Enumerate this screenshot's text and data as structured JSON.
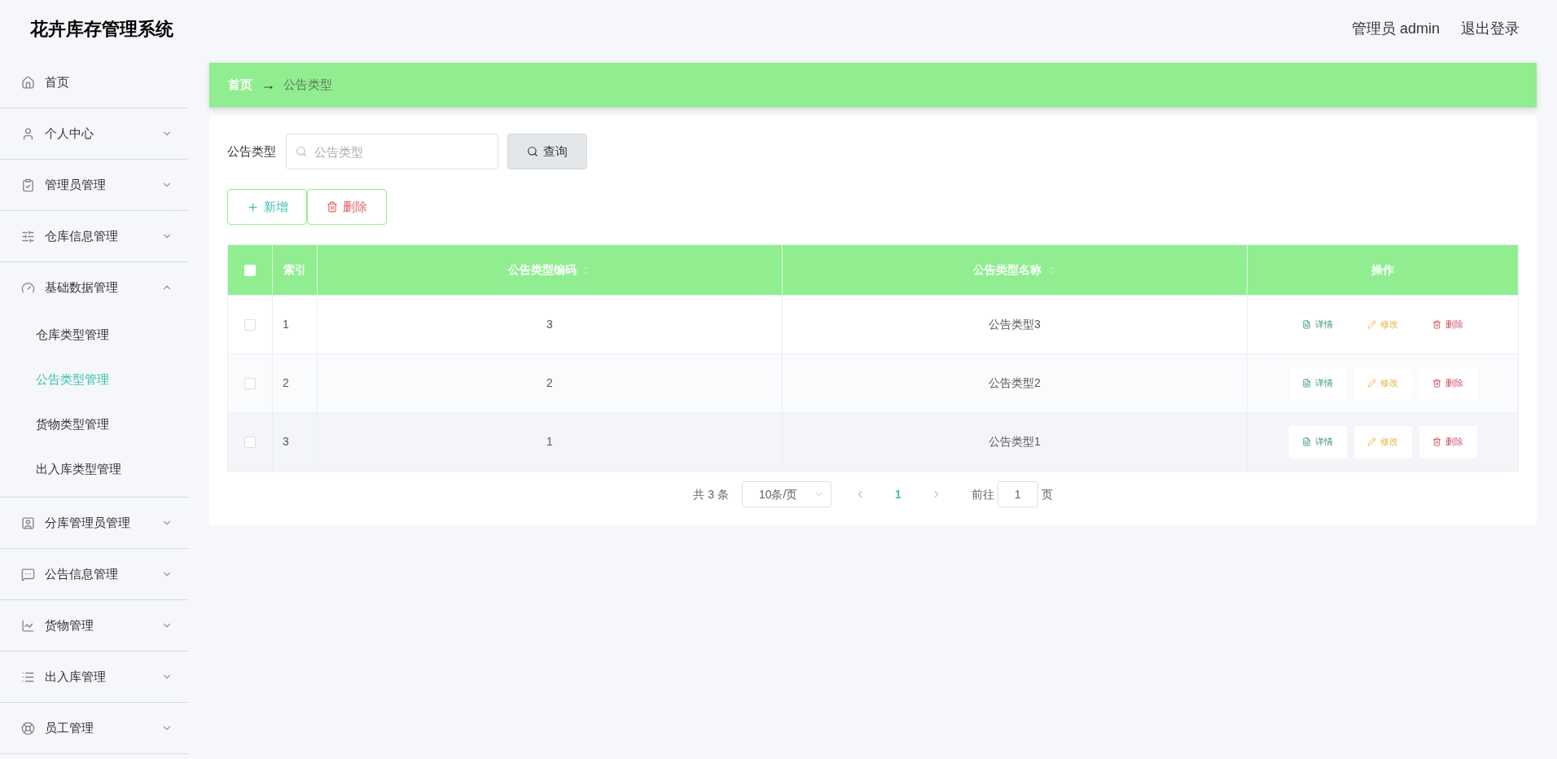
{
  "header": {
    "title": "花卉库存管理系统",
    "user": "管理员 admin",
    "logout": "退出登录"
  },
  "sidebar": {
    "items": [
      {
        "label": "首页"
      },
      {
        "label": "个人中心",
        "expanded": false
      },
      {
        "label": "管理员管理",
        "expanded": false
      },
      {
        "label": "仓库信息管理",
        "expanded": false
      },
      {
        "label": "基础数据管理",
        "expanded": true,
        "children": [
          {
            "label": "仓库类型管理",
            "selected": false
          },
          {
            "label": "公告类型管理",
            "selected": true
          },
          {
            "label": "货物类型管理",
            "selected": false
          },
          {
            "label": "出入库类型管理",
            "selected": false
          }
        ]
      },
      {
        "label": "分库管理员管理",
        "expanded": false
      },
      {
        "label": "公告信息管理",
        "expanded": false
      },
      {
        "label": "货物管理",
        "expanded": false
      },
      {
        "label": "出入库管理",
        "expanded": false
      },
      {
        "label": "员工管理",
        "expanded": false
      }
    ]
  },
  "breadcrumb": {
    "home": "首页",
    "separator": "→",
    "current": "公告类型"
  },
  "search": {
    "label": "公告类型",
    "placeholder": "公告类型",
    "button": "查询"
  },
  "actions": {
    "add": "新增",
    "delete": "删除"
  },
  "table": {
    "select_all_checked": false,
    "columns": [
      "索引",
      "公告类型编码",
      "公告类型名称",
      "操作"
    ],
    "rows": [
      {
        "index": "1",
        "code": "3",
        "name": "公告类型3",
        "checked": false,
        "actions": [
          "详情",
          "修改",
          "删除"
        ]
      },
      {
        "index": "2",
        "code": "2",
        "name": "公告类型2",
        "checked": false,
        "actions": [
          "详情",
          "修改",
          "删除"
        ]
      },
      {
        "index": "3",
        "code": "1",
        "name": "公告类型1",
        "checked": false,
        "actions": [
          "详情",
          "修改",
          "删除"
        ]
      }
    ]
  },
  "pagination": {
    "total": "共 3 条",
    "page_size": "10条/页",
    "current_page": "1",
    "goto_label": "前往",
    "goto_value": "1",
    "page_suffix": "页"
  }
}
